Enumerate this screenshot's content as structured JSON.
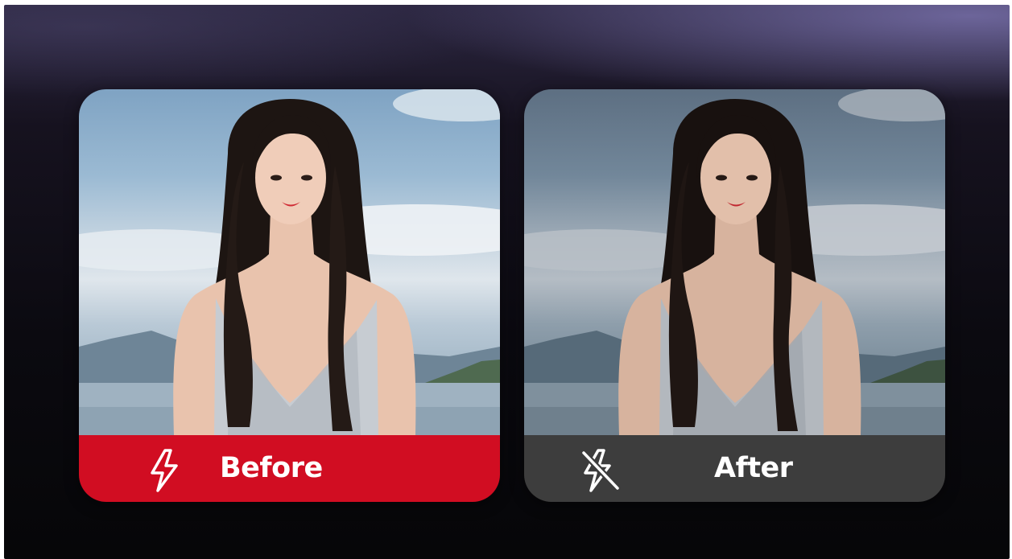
{
  "comparison": {
    "before": {
      "label": "Before",
      "icon": "flash-on-icon",
      "bar_color": "#d10d22"
    },
    "after": {
      "label": "After",
      "icon": "flash-off-icon",
      "bar_color": "#3d3d3d"
    }
  }
}
